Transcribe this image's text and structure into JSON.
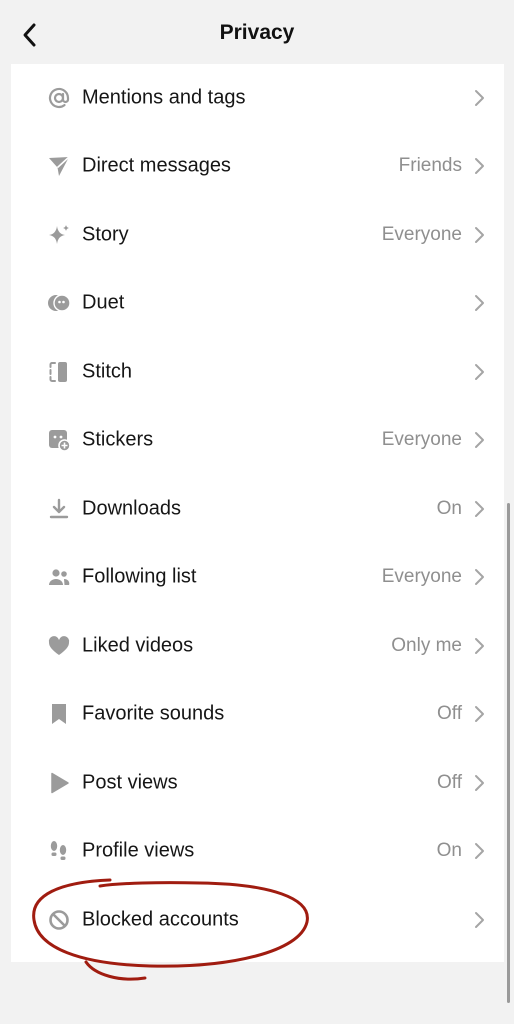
{
  "header": {
    "title": "Privacy"
  },
  "icons": {
    "back": "chevron-left-icon",
    "chevron": "chevron-right-icon"
  },
  "colors": {
    "icon": "#9b9b9b",
    "value_text": "#8f8f8f",
    "label_text": "#161616",
    "annotation": "#a01c10"
  },
  "items": [
    {
      "key": "mentions",
      "label": "Mentions and tags",
      "value": "",
      "icon": "at-icon"
    },
    {
      "key": "direct-messages",
      "label": "Direct messages",
      "value": "Friends",
      "icon": "paper-plane-icon"
    },
    {
      "key": "story",
      "label": "Story",
      "value": "Everyone",
      "icon": "sparkle-icon"
    },
    {
      "key": "duet",
      "label": "Duet",
      "value": "",
      "icon": "duet-icon"
    },
    {
      "key": "stitch",
      "label": "Stitch",
      "value": "",
      "icon": "stitch-icon"
    },
    {
      "key": "stickers",
      "label": "Stickers",
      "value": "Everyone",
      "icon": "sticker-icon"
    },
    {
      "key": "downloads",
      "label": "Downloads",
      "value": "On",
      "icon": "download-icon"
    },
    {
      "key": "following-list",
      "label": "Following list",
      "value": "Everyone",
      "icon": "people-icon"
    },
    {
      "key": "liked-videos",
      "label": "Liked videos",
      "value": "Only me",
      "icon": "heart-icon"
    },
    {
      "key": "favorite-sounds",
      "label": "Favorite sounds",
      "value": "Off",
      "icon": "bookmark-icon"
    },
    {
      "key": "post-views",
      "label": "Post views",
      "value": "Off",
      "icon": "play-icon"
    },
    {
      "key": "profile-views",
      "label": "Profile views",
      "value": "On",
      "icon": "footprints-icon"
    },
    {
      "key": "blocked-accounts",
      "label": "Blocked accounts",
      "value": "",
      "icon": "blocked-icon"
    }
  ]
}
